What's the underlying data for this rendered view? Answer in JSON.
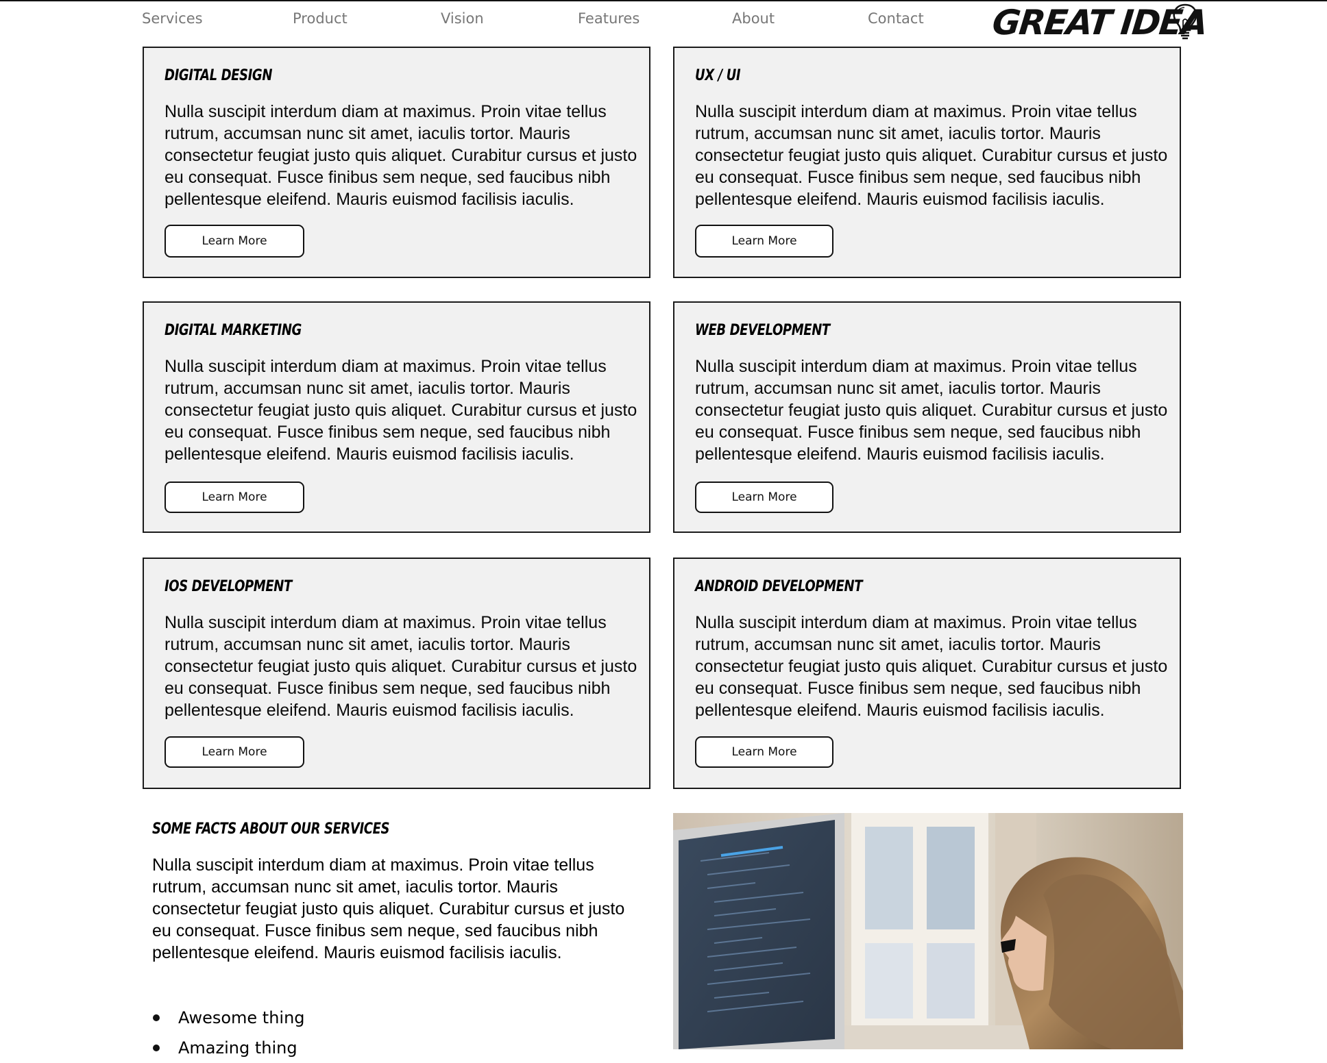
{
  "nav": {
    "items": [
      {
        "label": "Services"
      },
      {
        "label": "Product"
      },
      {
        "label": "Vision"
      },
      {
        "label": "Features"
      },
      {
        "label": "About"
      },
      {
        "label": "Contact"
      }
    ],
    "logo_text": "GREAT IDEA"
  },
  "cards": [
    {
      "title": "Digital Design",
      "body": "Nulla suscipit interdum diam at maximus. Proin vitae tellus rutrum, accumsan nunc sit amet, iaculis tortor. Mauris consectetur feugiat justo quis aliquet. Curabitur cursus et justo eu consequat. Fusce finibus sem neque, sed faucibus nibh pellentesque eleifend. Mauris euismod facilisis iaculis.",
      "button": "Learn More"
    },
    {
      "title": "UX / UI",
      "body": "Nulla suscipit interdum diam at maximus. Proin vitae tellus rutrum, accumsan nunc sit amet, iaculis tortor. Mauris consectetur feugiat justo quis aliquet. Curabitur cursus et justo eu consequat. Fusce finibus sem neque, sed faucibus nibh pellentesque eleifend. Mauris euismod facilisis iaculis.",
      "button": "Learn More"
    },
    {
      "title": "Digital Marketing",
      "body": "Nulla suscipit interdum diam at maximus. Proin vitae tellus rutrum, accumsan nunc sit amet, iaculis tortor. Mauris consectetur feugiat justo quis aliquet. Curabitur cursus et justo eu consequat. Fusce finibus sem neque, sed faucibus nibh pellentesque eleifend. Mauris euismod facilisis iaculis.",
      "button": "Learn More"
    },
    {
      "title": "Web Development",
      "body": "Nulla suscipit interdum diam at maximus. Proin vitae tellus rutrum, accumsan nunc sit amet, iaculis tortor. Mauris consectetur feugiat justo quis aliquet. Curabitur cursus et justo eu consequat. Fusce finibus sem neque, sed faucibus nibh pellentesque eleifend. Mauris euismod facilisis iaculis.",
      "button": "Learn More"
    },
    {
      "title": "iOS Development",
      "body": "Nulla suscipit interdum diam at maximus. Proin vitae tellus rutrum, accumsan nunc sit amet, iaculis tortor. Mauris consectetur feugiat justo quis aliquet. Curabitur cursus et justo eu consequat. Fusce finibus sem neque, sed faucibus nibh pellentesque eleifend. Mauris euismod facilisis iaculis.",
      "button": "Learn More"
    },
    {
      "title": "Android Development",
      "body": "Nulla suscipit interdum diam at maximus. Proin vitae tellus rutrum, accumsan nunc sit amet, iaculis tortor. Mauris consectetur feugiat justo quis aliquet. Curabitur cursus et justo eu consequat. Fusce finibus sem neque, sed faucibus nibh pellentesque eleifend. Mauris euismod facilisis iaculis.",
      "button": "Learn More"
    }
  ],
  "facts": {
    "title": "Some Facts About Our Services",
    "body": "Nulla suscipit interdum diam at maximus. Proin vitae tellus rutrum, accumsan nunc sit amet, iaculis tortor. Mauris consectetur feugiat justo quis aliquet. Curabitur cursus et justo eu consequat. Fusce finibus sem neque, sed faucibus nibh pellentesque eleifend. Mauris euismod facilisis iaculis.",
    "list": [
      "Awesome thing",
      "Amazing thing"
    ]
  },
  "colors": {
    "nav_text": "#777777",
    "card_bg": "#f1f1f1",
    "card_border": "#1a1a1a",
    "text": "#000000"
  },
  "icons": {
    "logo": "lightbulb-icon",
    "photo": "woman-at-computer-photo"
  }
}
